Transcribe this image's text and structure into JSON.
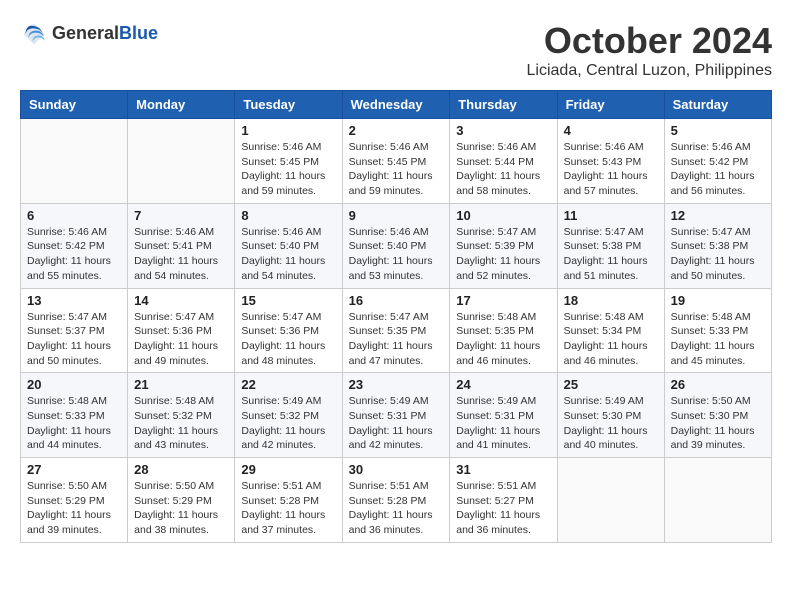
{
  "header": {
    "logo_general": "General",
    "logo_blue": "Blue",
    "month": "October 2024",
    "location": "Liciada, Central Luzon, Philippines"
  },
  "weekdays": [
    "Sunday",
    "Monday",
    "Tuesday",
    "Wednesday",
    "Thursday",
    "Friday",
    "Saturday"
  ],
  "weeks": [
    [
      {
        "day": "",
        "info": ""
      },
      {
        "day": "",
        "info": ""
      },
      {
        "day": "1",
        "info": "Sunrise: 5:46 AM\nSunset: 5:45 PM\nDaylight: 11 hours and 59 minutes."
      },
      {
        "day": "2",
        "info": "Sunrise: 5:46 AM\nSunset: 5:45 PM\nDaylight: 11 hours and 59 minutes."
      },
      {
        "day": "3",
        "info": "Sunrise: 5:46 AM\nSunset: 5:44 PM\nDaylight: 11 hours and 58 minutes."
      },
      {
        "day": "4",
        "info": "Sunrise: 5:46 AM\nSunset: 5:43 PM\nDaylight: 11 hours and 57 minutes."
      },
      {
        "day": "5",
        "info": "Sunrise: 5:46 AM\nSunset: 5:42 PM\nDaylight: 11 hours and 56 minutes."
      }
    ],
    [
      {
        "day": "6",
        "info": "Sunrise: 5:46 AM\nSunset: 5:42 PM\nDaylight: 11 hours and 55 minutes."
      },
      {
        "day": "7",
        "info": "Sunrise: 5:46 AM\nSunset: 5:41 PM\nDaylight: 11 hours and 54 minutes."
      },
      {
        "day": "8",
        "info": "Sunrise: 5:46 AM\nSunset: 5:40 PM\nDaylight: 11 hours and 54 minutes."
      },
      {
        "day": "9",
        "info": "Sunrise: 5:46 AM\nSunset: 5:40 PM\nDaylight: 11 hours and 53 minutes."
      },
      {
        "day": "10",
        "info": "Sunrise: 5:47 AM\nSunset: 5:39 PM\nDaylight: 11 hours and 52 minutes."
      },
      {
        "day": "11",
        "info": "Sunrise: 5:47 AM\nSunset: 5:38 PM\nDaylight: 11 hours and 51 minutes."
      },
      {
        "day": "12",
        "info": "Sunrise: 5:47 AM\nSunset: 5:38 PM\nDaylight: 11 hours and 50 minutes."
      }
    ],
    [
      {
        "day": "13",
        "info": "Sunrise: 5:47 AM\nSunset: 5:37 PM\nDaylight: 11 hours and 50 minutes."
      },
      {
        "day": "14",
        "info": "Sunrise: 5:47 AM\nSunset: 5:36 PM\nDaylight: 11 hours and 49 minutes."
      },
      {
        "day": "15",
        "info": "Sunrise: 5:47 AM\nSunset: 5:36 PM\nDaylight: 11 hours and 48 minutes."
      },
      {
        "day": "16",
        "info": "Sunrise: 5:47 AM\nSunset: 5:35 PM\nDaylight: 11 hours and 47 minutes."
      },
      {
        "day": "17",
        "info": "Sunrise: 5:48 AM\nSunset: 5:35 PM\nDaylight: 11 hours and 46 minutes."
      },
      {
        "day": "18",
        "info": "Sunrise: 5:48 AM\nSunset: 5:34 PM\nDaylight: 11 hours and 46 minutes."
      },
      {
        "day": "19",
        "info": "Sunrise: 5:48 AM\nSunset: 5:33 PM\nDaylight: 11 hours and 45 minutes."
      }
    ],
    [
      {
        "day": "20",
        "info": "Sunrise: 5:48 AM\nSunset: 5:33 PM\nDaylight: 11 hours and 44 minutes."
      },
      {
        "day": "21",
        "info": "Sunrise: 5:48 AM\nSunset: 5:32 PM\nDaylight: 11 hours and 43 minutes."
      },
      {
        "day": "22",
        "info": "Sunrise: 5:49 AM\nSunset: 5:32 PM\nDaylight: 11 hours and 42 minutes."
      },
      {
        "day": "23",
        "info": "Sunrise: 5:49 AM\nSunset: 5:31 PM\nDaylight: 11 hours and 42 minutes."
      },
      {
        "day": "24",
        "info": "Sunrise: 5:49 AM\nSunset: 5:31 PM\nDaylight: 11 hours and 41 minutes."
      },
      {
        "day": "25",
        "info": "Sunrise: 5:49 AM\nSunset: 5:30 PM\nDaylight: 11 hours and 40 minutes."
      },
      {
        "day": "26",
        "info": "Sunrise: 5:50 AM\nSunset: 5:30 PM\nDaylight: 11 hours and 39 minutes."
      }
    ],
    [
      {
        "day": "27",
        "info": "Sunrise: 5:50 AM\nSunset: 5:29 PM\nDaylight: 11 hours and 39 minutes."
      },
      {
        "day": "28",
        "info": "Sunrise: 5:50 AM\nSunset: 5:29 PM\nDaylight: 11 hours and 38 minutes."
      },
      {
        "day": "29",
        "info": "Sunrise: 5:51 AM\nSunset: 5:28 PM\nDaylight: 11 hours and 37 minutes."
      },
      {
        "day": "30",
        "info": "Sunrise: 5:51 AM\nSunset: 5:28 PM\nDaylight: 11 hours and 36 minutes."
      },
      {
        "day": "31",
        "info": "Sunrise: 5:51 AM\nSunset: 5:27 PM\nDaylight: 11 hours and 36 minutes."
      },
      {
        "day": "",
        "info": ""
      },
      {
        "day": "",
        "info": ""
      }
    ]
  ]
}
